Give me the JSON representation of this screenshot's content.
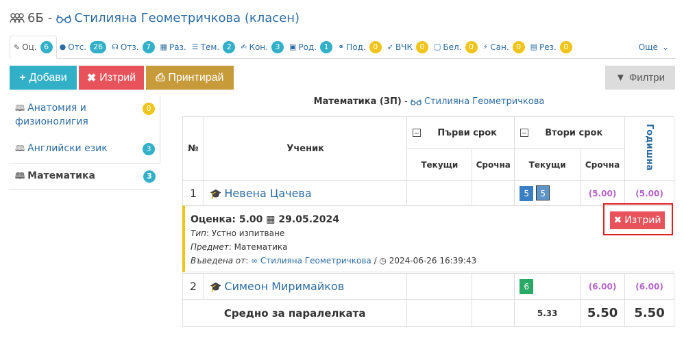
{
  "header": {
    "class_name": "6Б",
    "separator": "-",
    "teacher": "Стилияна Геометричкова (класен)"
  },
  "tabs": [
    {
      "label": "Оц.",
      "count": "6",
      "badge": "teal",
      "icon": "pencil-icon"
    },
    {
      "label": "Отс.",
      "count": "26",
      "badge": "teal",
      "icon": "info-icon"
    },
    {
      "label": "Отз.",
      "count": "7",
      "badge": "teal",
      "icon": "feedback-icon"
    },
    {
      "label": "Раз.",
      "count": "",
      "badge": "",
      "icon": "grid-icon"
    },
    {
      "label": "Тем.",
      "count": "2",
      "badge": "teal",
      "icon": "list-icon"
    },
    {
      "label": "Кон.",
      "count": "3",
      "badge": "teal",
      "icon": "edit-icon"
    },
    {
      "label": "Род.",
      "count": "1",
      "badge": "teal",
      "icon": "calendar-icon"
    },
    {
      "label": "Под.",
      "count": "0",
      "badge": "yellow",
      "icon": "handshake-icon"
    },
    {
      "label": "ВЧК",
      "count": "0",
      "badge": "yellow",
      "icon": "rocket-icon"
    },
    {
      "label": "Бел.",
      "count": "0",
      "badge": "yellow",
      "icon": "note-icon"
    },
    {
      "label": "Сан.",
      "count": "0",
      "badge": "yellow",
      "icon": "bolt-icon"
    },
    {
      "label": "Рез.",
      "count": "0",
      "badge": "yellow",
      "icon": "results-icon"
    }
  ],
  "tabs_more": "Още",
  "toolbar": {
    "add": "Добави",
    "delete": "Изтрий",
    "print": "Принтирай",
    "filter": "Филтри"
  },
  "subjects": [
    {
      "name": "Анатомия и физионолигия",
      "count": "0"
    },
    {
      "name": "Английски език",
      "count": "3"
    },
    {
      "name": "Математика",
      "count": "3"
    }
  ],
  "caption": {
    "subject": "Математика (ЗП)",
    "sep": "-",
    "teacher": "Стилияна Геометричкова"
  },
  "table": {
    "col_num": "№",
    "col_student": "Ученик",
    "term1": "Първи срок",
    "term2": "Втори срок",
    "yearly": "Годишна",
    "current": "Текущи",
    "term_final": "Срочна"
  },
  "students": [
    {
      "num": "1",
      "name": "Невена Цачева",
      "t2_grades": [
        "5",
        "5"
      ],
      "t2_final": "(5.00)",
      "yearly": "(5.00)"
    },
    {
      "num": "2",
      "name": "Симеон Миримайков",
      "t2_grades": [
        "6"
      ],
      "t2_final": "(6.00)",
      "yearly": "(6.00)"
    }
  ],
  "average": {
    "label": "Средно за паралелката",
    "t2_current": "5.33",
    "t2_final": "5.50",
    "yearly": "5.50"
  },
  "detail": {
    "title_prefix": "Оценка: 5.00",
    "date": "29.05.2024",
    "type_label": "Тип",
    "type_value": ": Устно изпитване",
    "subject_label": "Предмет",
    "subject_value": ": Математика",
    "entered_label": "Въведена от",
    "entered_sep": ":",
    "entered_by": "Стилияна Геометричкова",
    "entered_slash": "/",
    "entered_at": "2024-06-26 16:39:43",
    "delete_button": "Изтрий"
  },
  "colors": {
    "teal": "#31b0c8",
    "red": "#e8525a",
    "gold": "#c79a3a",
    "link": "#2d6ca2",
    "yellow_badge": "#f0c419",
    "purple_grade": "#b365c9",
    "green_grade": "#2aa866",
    "blue_grade": "#3a7ec4"
  }
}
